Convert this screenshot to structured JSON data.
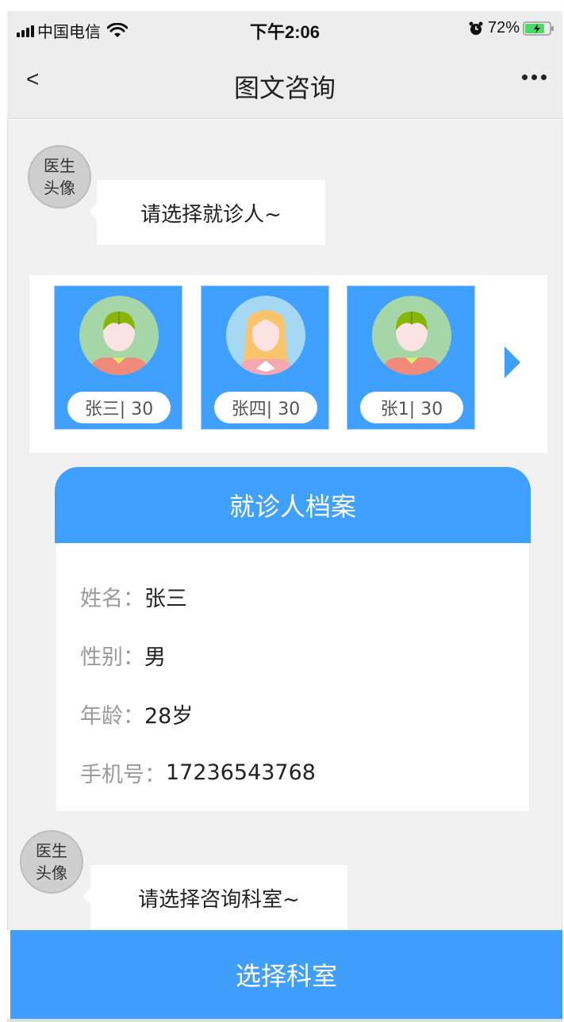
{
  "status_bar": {
    "carrier": "中国电信",
    "time": "下午2:06",
    "battery_percent": "72%",
    "icons": [
      "signal-icon",
      "wifi-icon",
      "alarm-icon",
      "battery-charging-icon"
    ]
  },
  "navbar": {
    "back_label": "<",
    "title": "图文咨询",
    "more_icon": "more-dots-icon"
  },
  "chat": {
    "messages": [
      {
        "avatar_label": "医生头像",
        "avatar_line1": "医生",
        "avatar_line2": "头像",
        "text": "请选择就诊人~"
      },
      {
        "avatar_label": "医生头像",
        "avatar_line1": "医生",
        "avatar_line2": "头像",
        "text": "请选择咨询科室~"
      }
    ]
  },
  "patients": [
    {
      "label": "张三| 30",
      "avatar": "boy-avatar-icon"
    },
    {
      "label": "张四| 30",
      "avatar": "girl-avatar-icon"
    },
    {
      "label": "张1| 30",
      "avatar": "boy-avatar-icon"
    }
  ],
  "patient_next_icon": "arrow-right-icon",
  "record": {
    "title": "就诊人档案",
    "name_label": "姓名：",
    "name_value": "张三",
    "gender_label": "性别：",
    "gender_value": "男",
    "age_label": "年龄：",
    "age_value": "28岁",
    "phone_label": "手机号：",
    "phone_value": "17236543768"
  },
  "bottom_button": {
    "label": "选择科室"
  },
  "colors": {
    "accent": "#409eff",
    "background": "#f1f1f1",
    "navbar": "#ededed"
  }
}
